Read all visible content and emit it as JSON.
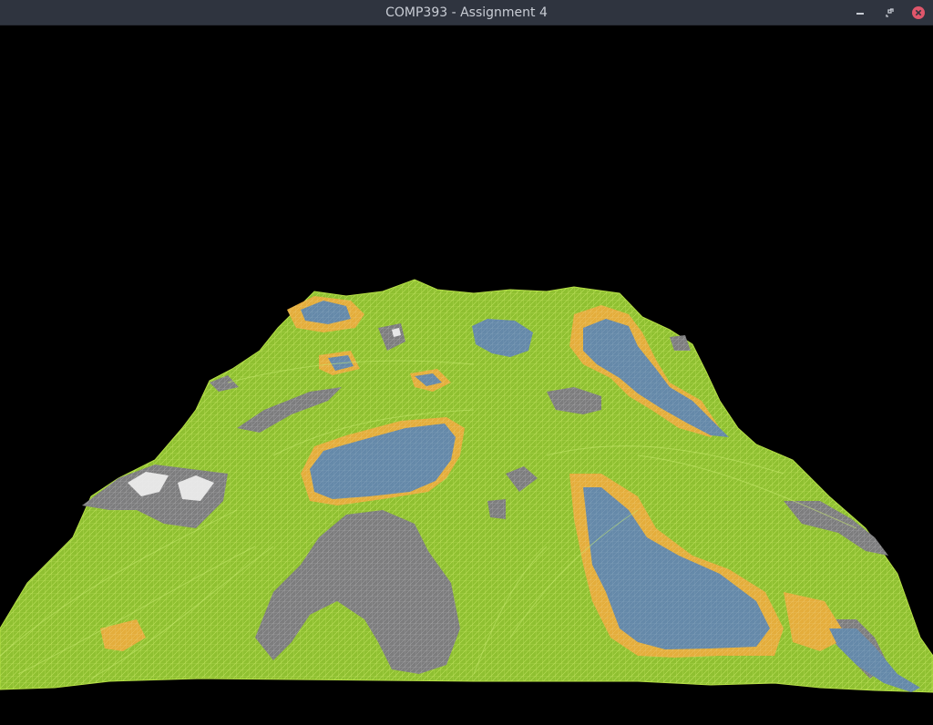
{
  "window": {
    "title": "COMP393 - Assignment 4"
  },
  "titlebar_buttons": [
    {
      "name": "minimize-button",
      "icon": "minimize-icon"
    },
    {
      "name": "maximize-button",
      "icon": "maximize-icon"
    },
    {
      "name": "close-button",
      "icon": "close-icon"
    }
  ],
  "colors": {
    "titlebar_bg": "#2f343f",
    "title_text": "#c8ccd4",
    "close_accent": "#e0566b",
    "background": "#000000",
    "grass": "#8fc031",
    "grass_line": "#b5df45",
    "water": "#6589a9",
    "sand": "#e4ad3c",
    "rock": "#7f7f80",
    "snow": "#f3f3f3"
  },
  "viewport": {
    "content": "wireframe terrain mesh rendering"
  }
}
